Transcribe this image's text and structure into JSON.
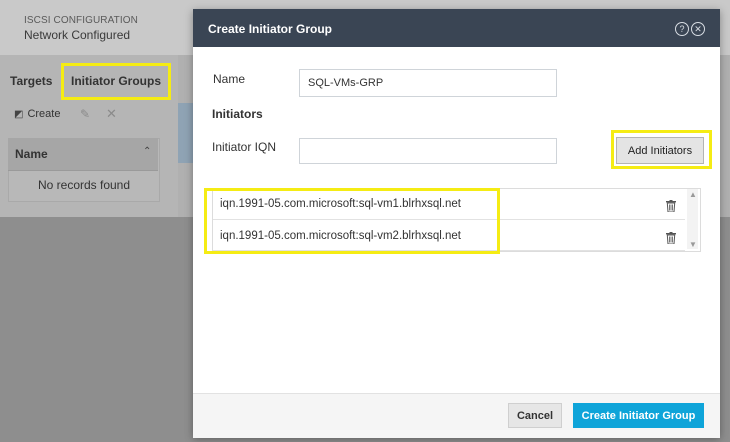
{
  "background": {
    "status_label": "ISCSI CONFIGURATION",
    "status_value": "Network Configured",
    "tabs": [
      {
        "label": "Targets"
      },
      {
        "label": "Initiator Groups"
      }
    ],
    "toolbar": {
      "create_label": "Create",
      "edit_label": "✎",
      "delete_label": "✕"
    },
    "grid": {
      "column_name": "Name",
      "sort_glyph": "⌃",
      "empty_text": "No records found"
    }
  },
  "modal": {
    "title": "Create Initiator Group",
    "help_glyph": "?",
    "close_glyph": "✕",
    "name_label": "Name",
    "name_value": "SQL-VMs-GRP",
    "initiators_heading": "Initiators",
    "iqn_label": "Initiator IQN",
    "iqn_value": "",
    "add_button": "Add Initiators",
    "initiators": [
      "iqn.1991-05.com.microsoft:sql-vm1.blrhxsql.net",
      "iqn.1991-05.com.microsoft:sql-vm2.blrhxsql.net"
    ],
    "cancel_button": "Cancel",
    "create_button": "Create Initiator Group"
  },
  "colors": {
    "modal_header": "#3a4554",
    "primary_button": "#0ea4d9",
    "highlight": "#f5ec14"
  }
}
